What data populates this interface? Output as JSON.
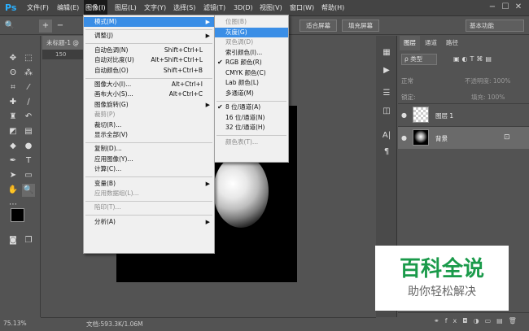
{
  "app": {
    "logo": "Ps"
  },
  "menubar": {
    "items": [
      "文件(F)",
      "编辑(E)",
      "图像(I)",
      "图层(L)",
      "文字(Y)",
      "选择(S)",
      "滤镜(T)",
      "3D(D)",
      "视图(V)",
      "窗口(W)",
      "帮助(H)"
    ],
    "active_index": 2
  },
  "window_controls": {
    "minimize": "−",
    "maximize": "☐",
    "close": "✕"
  },
  "options_bar": {
    "fit_screen": "适合屏幕",
    "fill_screen": "填充屏幕",
    "workspace": "基本功能"
  },
  "document": {
    "tab": "未标题-1 @",
    "ruler_mark": "150"
  },
  "image_menu": {
    "items": [
      {
        "label": "模式(M)",
        "shortcut": "",
        "arrow": true,
        "disabled": false,
        "highlight": true
      },
      {
        "sep": true
      },
      {
        "label": "调整(J)",
        "shortcut": "",
        "arrow": true,
        "disabled": false
      },
      {
        "sep": true
      },
      {
        "label": "自动色调(N)",
        "shortcut": "Shift+Ctrl+L",
        "disabled": false
      },
      {
        "label": "自动对比度(U)",
        "shortcut": "Alt+Shift+Ctrl+L",
        "disabled": false
      },
      {
        "label": "自动颜色(O)",
        "shortcut": "Shift+Ctrl+B",
        "disabled": false
      },
      {
        "sep": true
      },
      {
        "label": "图像大小(I)...",
        "shortcut": "Alt+Ctrl+I",
        "disabled": false
      },
      {
        "label": "画布大小(S)...",
        "shortcut": "Alt+Ctrl+C",
        "disabled": false
      },
      {
        "label": "图像旋转(G)",
        "shortcut": "",
        "arrow": true,
        "disabled": false
      },
      {
        "label": "裁剪(P)",
        "shortcut": "",
        "disabled": true
      },
      {
        "label": "裁切(R)...",
        "shortcut": "",
        "disabled": false
      },
      {
        "label": "显示全部(V)",
        "shortcut": "",
        "disabled": false
      },
      {
        "sep": true
      },
      {
        "label": "复制(D)...",
        "shortcut": "",
        "disabled": false
      },
      {
        "label": "应用图像(Y)...",
        "shortcut": "",
        "disabled": false
      },
      {
        "label": "计算(C)...",
        "shortcut": "",
        "disabled": false
      },
      {
        "sep": true
      },
      {
        "label": "变量(B)",
        "shortcut": "",
        "arrow": true,
        "disabled": false
      },
      {
        "label": "应用数据组(L)...",
        "shortcut": "",
        "disabled": true
      },
      {
        "sep": true
      },
      {
        "label": "陷印(T)...",
        "shortcut": "",
        "disabled": true
      },
      {
        "sep": true
      },
      {
        "label": "分析(A)",
        "shortcut": "",
        "arrow": true,
        "disabled": false
      }
    ]
  },
  "mode_submenu": {
    "items": [
      {
        "label": "位图(B)",
        "disabled": true
      },
      {
        "label": "灰度(G)",
        "disabled": false,
        "highlight": true
      },
      {
        "label": "双色调(D)",
        "disabled": true
      },
      {
        "label": "索引颜色(I)...",
        "disabled": false
      },
      {
        "label": "RGB 颜色(R)",
        "disabled": false,
        "checked": true
      },
      {
        "label": "CMYK 颜色(C)",
        "disabled": false
      },
      {
        "label": "Lab 颜色(L)",
        "disabled": false
      },
      {
        "label": "多通道(M)",
        "disabled": false
      },
      {
        "sep": true
      },
      {
        "label": "8 位/通道(A)",
        "disabled": false,
        "checked": true
      },
      {
        "label": "16 位/通道(N)",
        "disabled": false
      },
      {
        "label": "32 位/通道(H)",
        "disabled": false
      },
      {
        "sep": true
      },
      {
        "label": "颜色表(T)...",
        "disabled": true
      }
    ]
  },
  "layers_panel": {
    "tabs": [
      "图层",
      "通道",
      "路径"
    ],
    "filter_label": "ρ 类型",
    "blend_mode": "正常",
    "opacity_label": "不透明度: 100%",
    "lock_label": "锁定:",
    "fill_label": "填充: 100%",
    "layers": [
      {
        "name": "图层 1",
        "selected": false
      },
      {
        "name": "背景",
        "selected": true
      }
    ]
  },
  "status": {
    "zoom": "75.13%",
    "doc_info": "文档:593.3K/1.06M"
  },
  "watermark": {
    "title": "百科全说",
    "subtitle": "助你轻松解决"
  },
  "colors": {
    "accent": "#3a8ee6",
    "brand_green": "#1a9a4a",
    "ps_blue": "#2ab0ff"
  }
}
